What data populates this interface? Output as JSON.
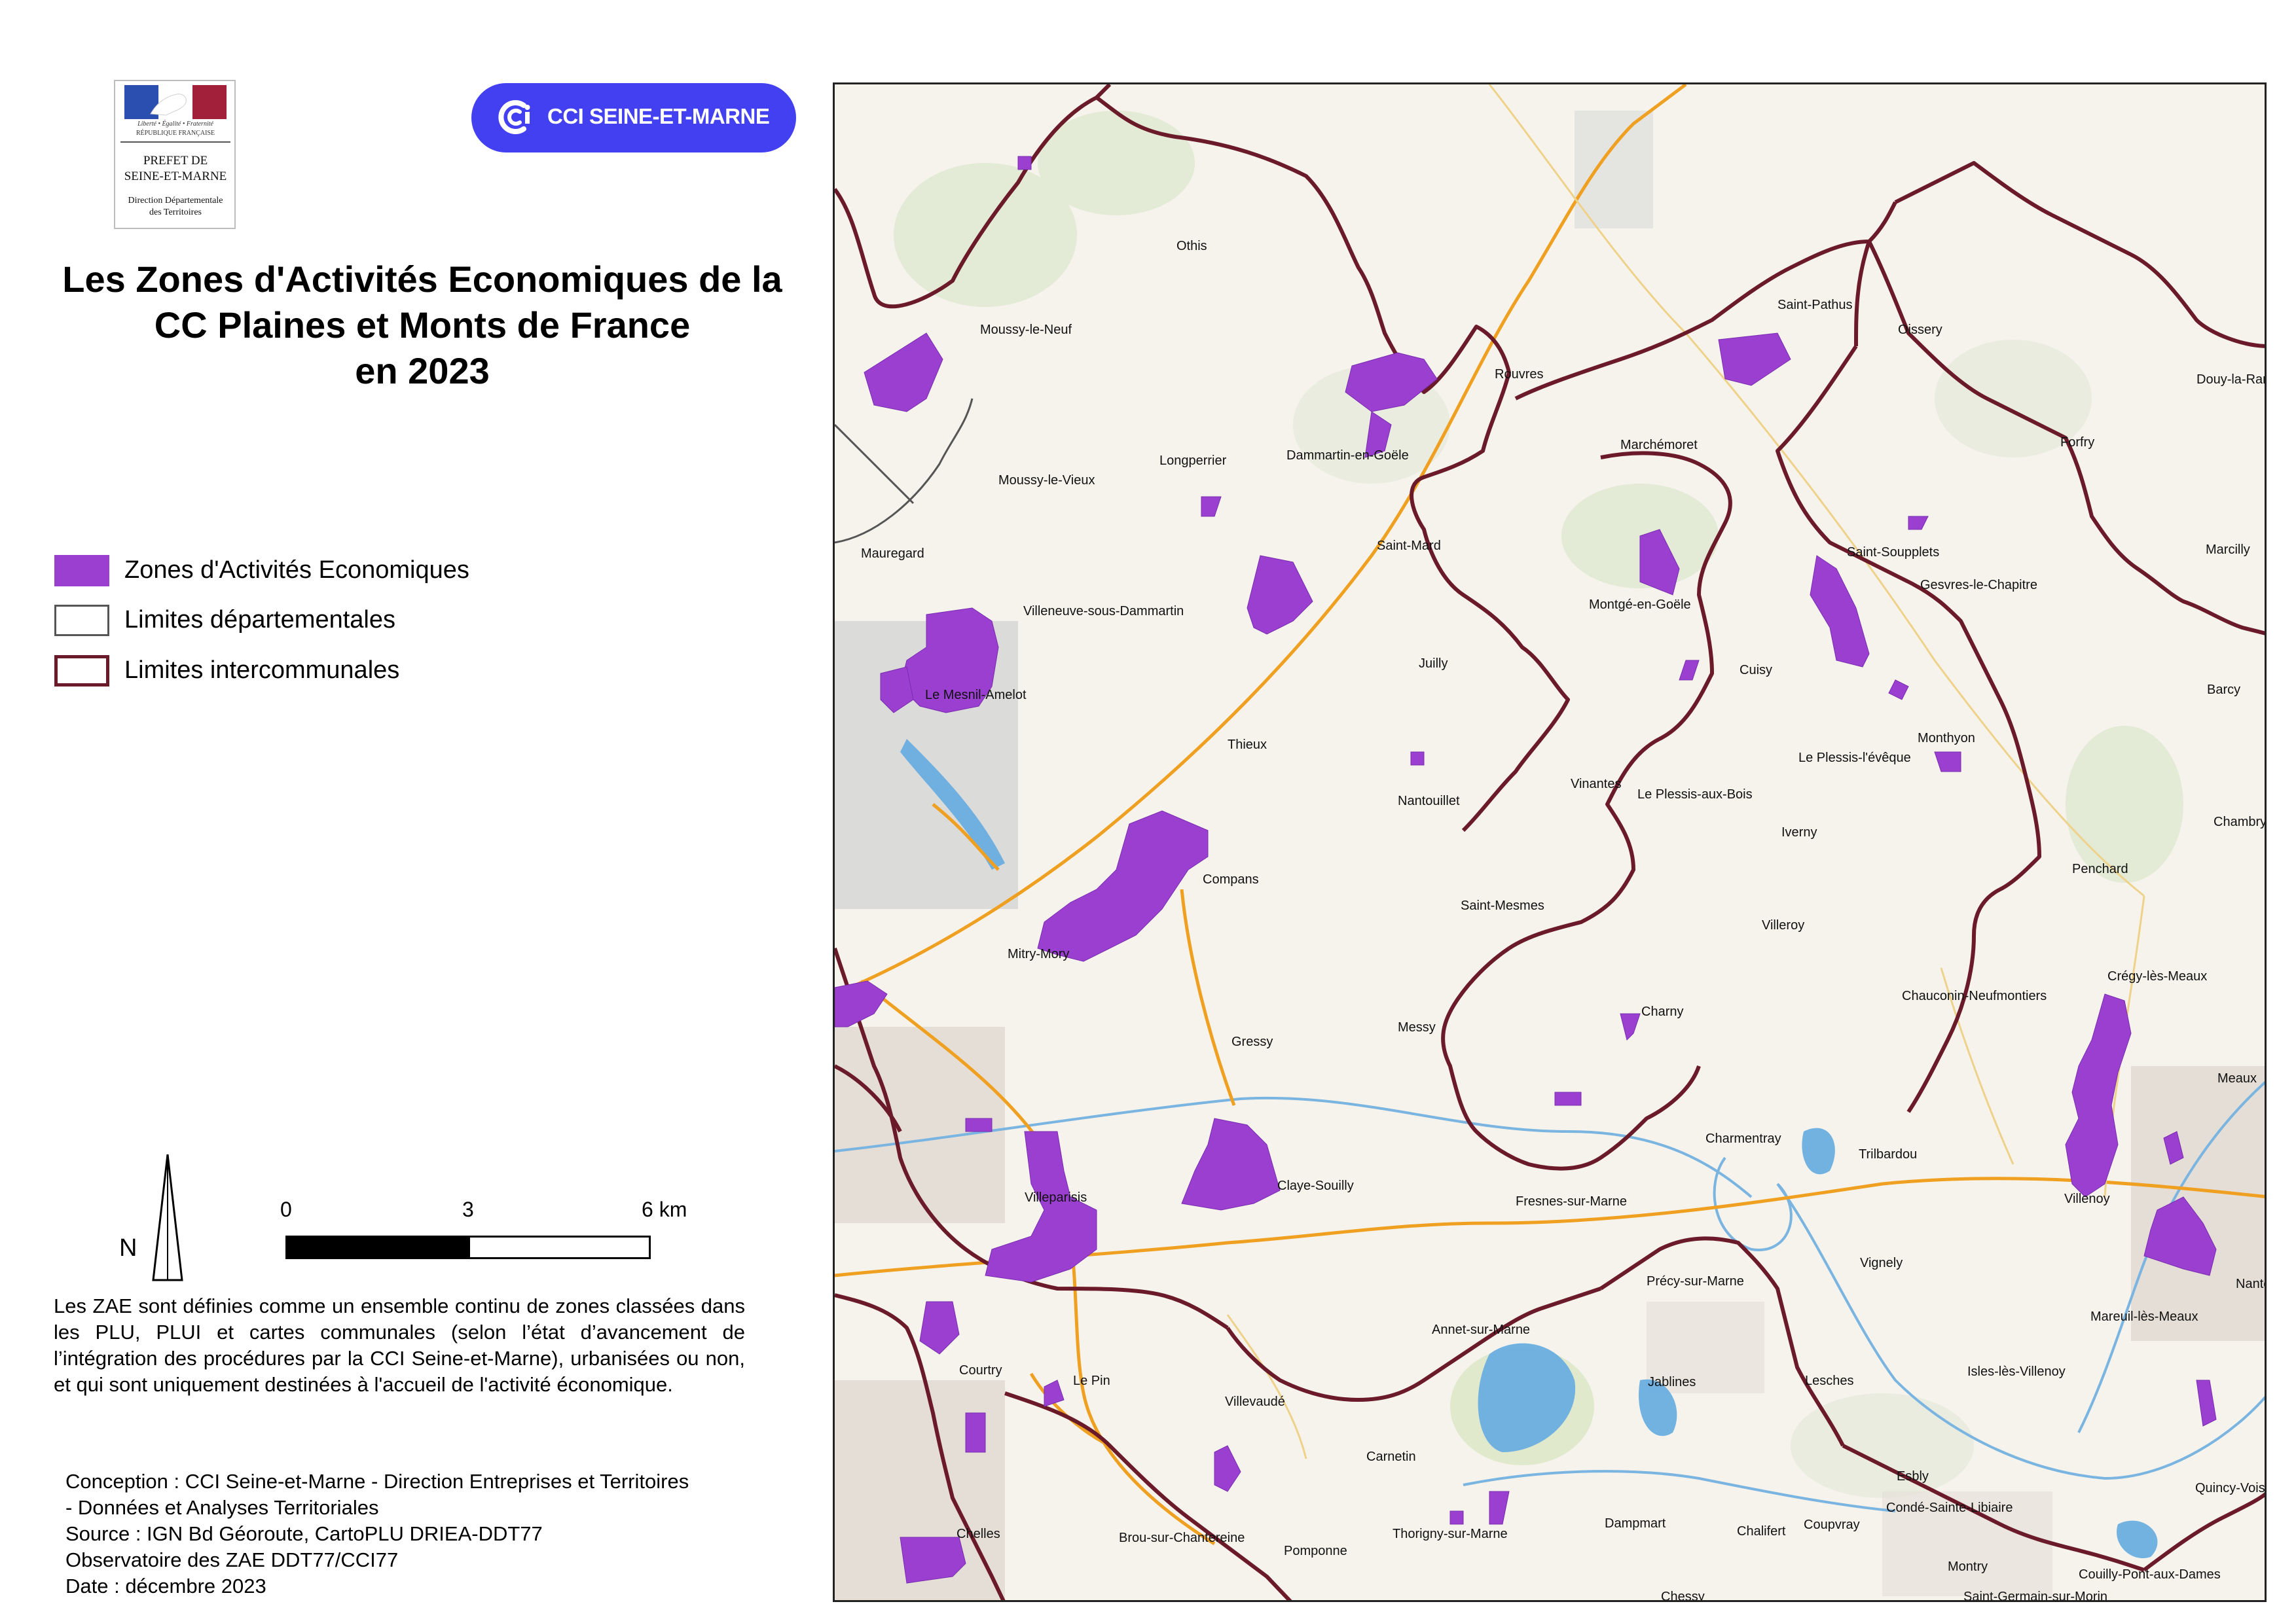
{
  "logos": {
    "prefet": {
      "motto": "Liberté • Égalité • Fraternité",
      "republic": "RÉPUBLIQUE FRANÇAISE",
      "line1": "PREFET DE",
      "line2": "SEINE-ET-MARNE",
      "line3": "Direction Départementale",
      "line4": "des Territoires"
    },
    "cci": {
      "text": "CCI SEINE-ET-MARNE",
      "color": "#4340f2"
    }
  },
  "title": {
    "line1": "Les Zones d'Activités Economiques de la",
    "line2": "CC Plaines et Monts de France",
    "line3": "en 2023"
  },
  "legend": [
    {
      "label": "Zones d'Activités Economiques",
      "color": "#9b3fd1",
      "kind": "fill"
    },
    {
      "label": "Limites départementales",
      "color": "#555555",
      "kind": "outline"
    },
    {
      "label": "Limites intercommunales",
      "color": "#6b1a2a",
      "kind": "outline"
    }
  ],
  "north": {
    "label": "N"
  },
  "scale": {
    "labels": [
      "0",
      "3",
      "6 km"
    ]
  },
  "note": "Les ZAE sont définies comme un ensemble continu de zones classées dans les PLU, PLUI et cartes communales (selon l’état d’avancement de l’intégration des procédures par la CCI Seine-et-Marne), urbanisées ou non, et qui sont uniquement destinées à l'accueil de l'activité économique.",
  "credits": {
    "line1": "Conception : CCI Seine-et-Marne - Direction Entreprises et Territoires",
    "line2": "- Données et Analyses Territoriales",
    "line3": "Source : IGN Bd Géoroute, CartoPLU DRIEA-DDT77",
    "line4": "Observatoire des ZAE DDT77/CCI77",
    "line5": "Date : décembre 2023"
  },
  "map": {
    "colors": {
      "zae": "#9b3fd1",
      "interco": "#6b1a2a",
      "road": "#f0a020",
      "water": "#6aaee0",
      "background": "#f5f3ec"
    },
    "towns": [
      "Othis",
      "Moussy-le-Neuf",
      "Saint-Pathus",
      "Oissery",
      "Rouvres",
      "Douy-la-Ramée",
      "Longperrier",
      "Dammartin-en-Goële",
      "Marchémoret",
      "Forfry",
      "Moussy-le-Vieux",
      "Mauregard",
      "Saint-Mard",
      "Saint-Soupplets",
      "Gesvres-le-Chapitre",
      "Marcilly",
      "Villeneuve-sous-Dammartin",
      "Montgé-en-Goële",
      "Juilly",
      "Cuisy",
      "Barcy",
      "Le Mesnil-Amelot",
      "Thieux",
      "Monthyon",
      "Le Plessis-l'évêque",
      "Nantouillet",
      "Vinantes",
      "Le Plessis-aux-Bois",
      "Iverny",
      "Chambry",
      "Penchard",
      "Compans",
      "Saint-Mesmes",
      "Villeroy",
      "Mitry-Mory",
      "Crégy-lès-Meaux",
      "Chauconin-Neufmontiers",
      "Charny",
      "Messy",
      "Gressy",
      "Meaux",
      "Charmentray",
      "Trilbardou",
      "Claye-Souilly",
      "Fresnes-sur-Marne",
      "Villeparisis",
      "Villenoy",
      "Vignely",
      "Précy-sur-Marne",
      "Nanteuil",
      "Mareuil-lès-Meaux",
      "Annet-sur-Marne",
      "Courtry",
      "Le Pin",
      "Jablines",
      "Lesches",
      "Isles-lès-Villenoy",
      "Villevaudé",
      "Carnetin",
      "Esbly",
      "Quincy-Voisins",
      "Dampmart",
      "Chalifert",
      "Coupvray",
      "Condé-Sainte-Libiaire",
      "Chelles",
      "Brou-sur-Chantereine",
      "Pomponne",
      "Thorigny-sur-Marne",
      "Montry",
      "Couilly-Pont-aux-Dames",
      "Chessy",
      "Saint-Germain-sur-Morin"
    ]
  }
}
